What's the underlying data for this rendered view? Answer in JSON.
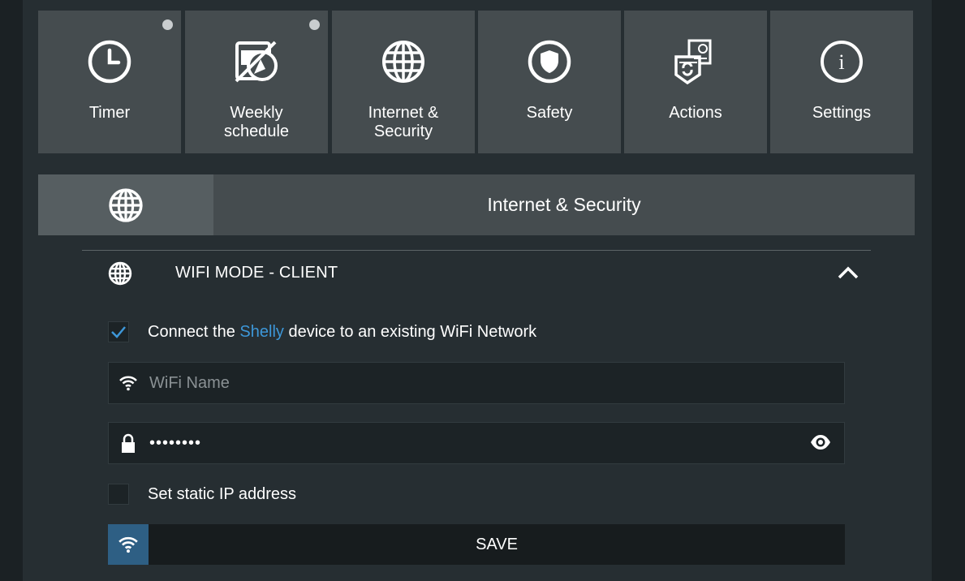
{
  "tiles": [
    {
      "label": "Timer",
      "icon": "clock-icon",
      "indicator": true
    },
    {
      "label": "Weekly\nschedule",
      "icon": "schedule-disabled-icon",
      "indicator": true
    },
    {
      "label": "Internet &\nSecurity",
      "icon": "globe-icon",
      "indicator": false
    },
    {
      "label": "Safety",
      "icon": "shield-icon",
      "indicator": false
    },
    {
      "label": "Actions",
      "icon": "actions-icon",
      "indicator": false
    },
    {
      "label": "Settings",
      "icon": "info-icon",
      "indicator": false
    }
  ],
  "section": {
    "title": "Internet & Security",
    "icon": "globe-icon"
  },
  "wifi": {
    "title": "WIFI MODE - CLIENT",
    "expanded": true,
    "connect_checked": true,
    "connect_prefix": "Connect the ",
    "connect_brand": "Shelly",
    "connect_suffix": " device to an existing WiFi Network",
    "name_placeholder": "WiFi Name",
    "name_value": "",
    "password_value": "••••••••",
    "static_ip_label": "Set static IP address",
    "static_ip_checked": false,
    "save_label": "SAVE"
  },
  "colors": {
    "accent": "#3d97d8",
    "save_icon_bg": "#2e5f84",
    "tile_bg": "#454c4f"
  }
}
